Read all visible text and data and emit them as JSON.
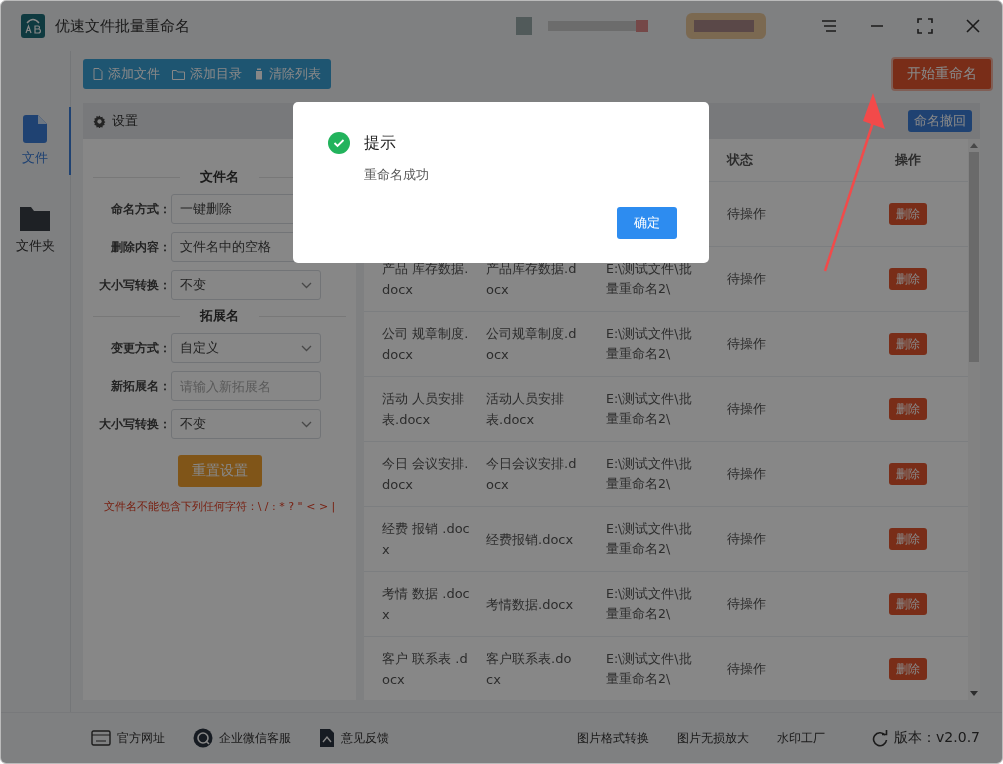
{
  "app": {
    "title": "优速文件批量重命名"
  },
  "toolbar": {
    "buttons": [
      "添加文件",
      "添加目录",
      "清除列表"
    ],
    "start_button": "开始重命名"
  },
  "sidebar": [
    {
      "label": "文件",
      "selected": true
    },
    {
      "label": "文件夹",
      "selected": false
    }
  ],
  "settings": {
    "title": "设置",
    "sections": [
      {
        "title": "文件名",
        "fields": [
          {
            "label": "命名方式：",
            "value": "一键删除",
            "kind": "text"
          },
          {
            "label": "删除内容：",
            "value": "文件名中的空格",
            "kind": "text"
          },
          {
            "label": "大小写转换：",
            "value": "不变",
            "kind": "select"
          }
        ]
      },
      {
        "title": "拓展名",
        "fields": [
          {
            "label": "变更方式：",
            "value": "自定义",
            "kind": "select"
          },
          {
            "label": "新拓展名：",
            "placeholder": "请输入新拓展名",
            "kind": "input"
          },
          {
            "label": "大小写转换：",
            "value": "不变",
            "kind": "select"
          }
        ]
      }
    ],
    "reset_button": "重置设置",
    "warning": "文件名不能包含下列任何字符：\\ / : * ? \" < > |"
  },
  "undo_button": "命名撤回",
  "table": {
    "columns": [
      "状态",
      "操作"
    ],
    "rows": [
      {
        "status": "待操作",
        "action": "删除"
      },
      {
        "original": "产品 库存数据.docx",
        "new": "产品库存数据.docx",
        "path": "E:\\测试文件\\批量重命名2\\",
        "status": "待操作",
        "action": "删除"
      },
      {
        "original": "公司 规章制度.docx",
        "new": "公司规章制度.docx",
        "path": "E:\\测试文件\\批量重命名2\\",
        "status": "待操作",
        "action": "删除"
      },
      {
        "original": "活动 人员安排表.docx",
        "new": "活动人员安排表.docx",
        "path": "E:\\测试文件\\批量重命名2\\",
        "status": "待操作",
        "action": "删除"
      },
      {
        "original": "今日 会议安排.docx",
        "new": "今日会议安排.docx",
        "path": "E:\\测试文件\\批量重命名2\\",
        "status": "待操作",
        "action": "删除"
      },
      {
        "original": "经费 报销 .docx",
        "new": "经费报销.docx",
        "path": "E:\\测试文件\\批量重命名2\\",
        "status": "待操作",
        "action": "删除"
      },
      {
        "original": "考情 数据 .docx",
        "new": "考情数据.docx",
        "path": "E:\\测试文件\\批量重命名2\\",
        "status": "待操作",
        "action": "删除"
      },
      {
        "original": "客户 联系表 .docx",
        "new": "客户联系表.docx",
        "path": "E:\\测试文件\\批量重命名2\\",
        "status": "待操作",
        "action": "删除"
      }
    ]
  },
  "footer": {
    "links": [
      "官方网址",
      "企业微信客服",
      "意见反馈"
    ],
    "tools": [
      "图片格式转换",
      "图片无损放大",
      "水印工厂"
    ],
    "version": "版本：v2.0.7"
  },
  "dialog": {
    "title": "提示",
    "message": "重命名成功",
    "button": "确定"
  }
}
